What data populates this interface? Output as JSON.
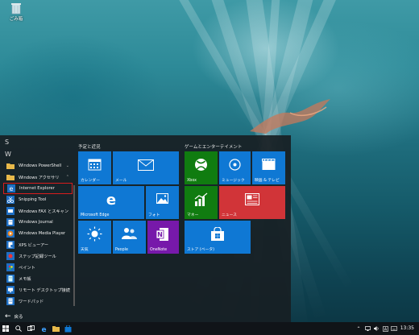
{
  "desktop": {
    "recycle_bin_label": "ごみ箱"
  },
  "start_menu": {
    "headers": {
      "s": "S",
      "w": "W"
    },
    "apps": [
      {
        "label": "Windows PowerShell",
        "icon": "folder-icon",
        "expandable": true
      },
      {
        "label": "Windows アクセサリ",
        "icon": "folder-icon",
        "expandable": true
      },
      {
        "label": "Internet Explorer",
        "icon": "internet-explorer-icon",
        "selected": true
      },
      {
        "label": "Snipping Tool",
        "icon": "scissors-icon"
      },
      {
        "label": "Windows FAX とスキャン",
        "icon": "fax-icon"
      },
      {
        "label": "Windows Journal",
        "icon": "journal-icon"
      },
      {
        "label": "Windows Media Player",
        "icon": "media-player-icon"
      },
      {
        "label": "XPS ビューアー",
        "icon": "xps-viewer-icon"
      },
      {
        "label": "ステップ記録ツール",
        "icon": "steps-recorder-icon"
      },
      {
        "label": "ペイント",
        "icon": "paint-icon"
      },
      {
        "label": "メモ帳",
        "icon": "notepad-icon"
      },
      {
        "label": "リモート デスクトップ接続",
        "icon": "remote-desktop-icon"
      },
      {
        "label": "ワードパッド",
        "icon": "wordpad-icon"
      }
    ],
    "back_label": "戻る",
    "groups": {
      "left": "予定と近況",
      "right": "ゲームとエンターテイメント"
    },
    "tiles": {
      "calendar": "カレンダー",
      "mail": "メール",
      "edge": "Microsoft Edge",
      "photos": "フォト",
      "weather": "天気",
      "people": "People",
      "onenote": "OneNote",
      "xbox": "Xbox",
      "music": "ミュージック",
      "movies": "映画 & テレビ",
      "money": "マネー",
      "news": "ニュース",
      "store": "ストア (ベータ)"
    }
  },
  "taskbar": {
    "clock": "13:35"
  },
  "colors": {
    "tile_blue": "#0f78d4",
    "xbox_green": "#107c10",
    "news_red": "#d13438",
    "onenote_purple": "#7719aa",
    "selection_border": "#d81d1d"
  }
}
